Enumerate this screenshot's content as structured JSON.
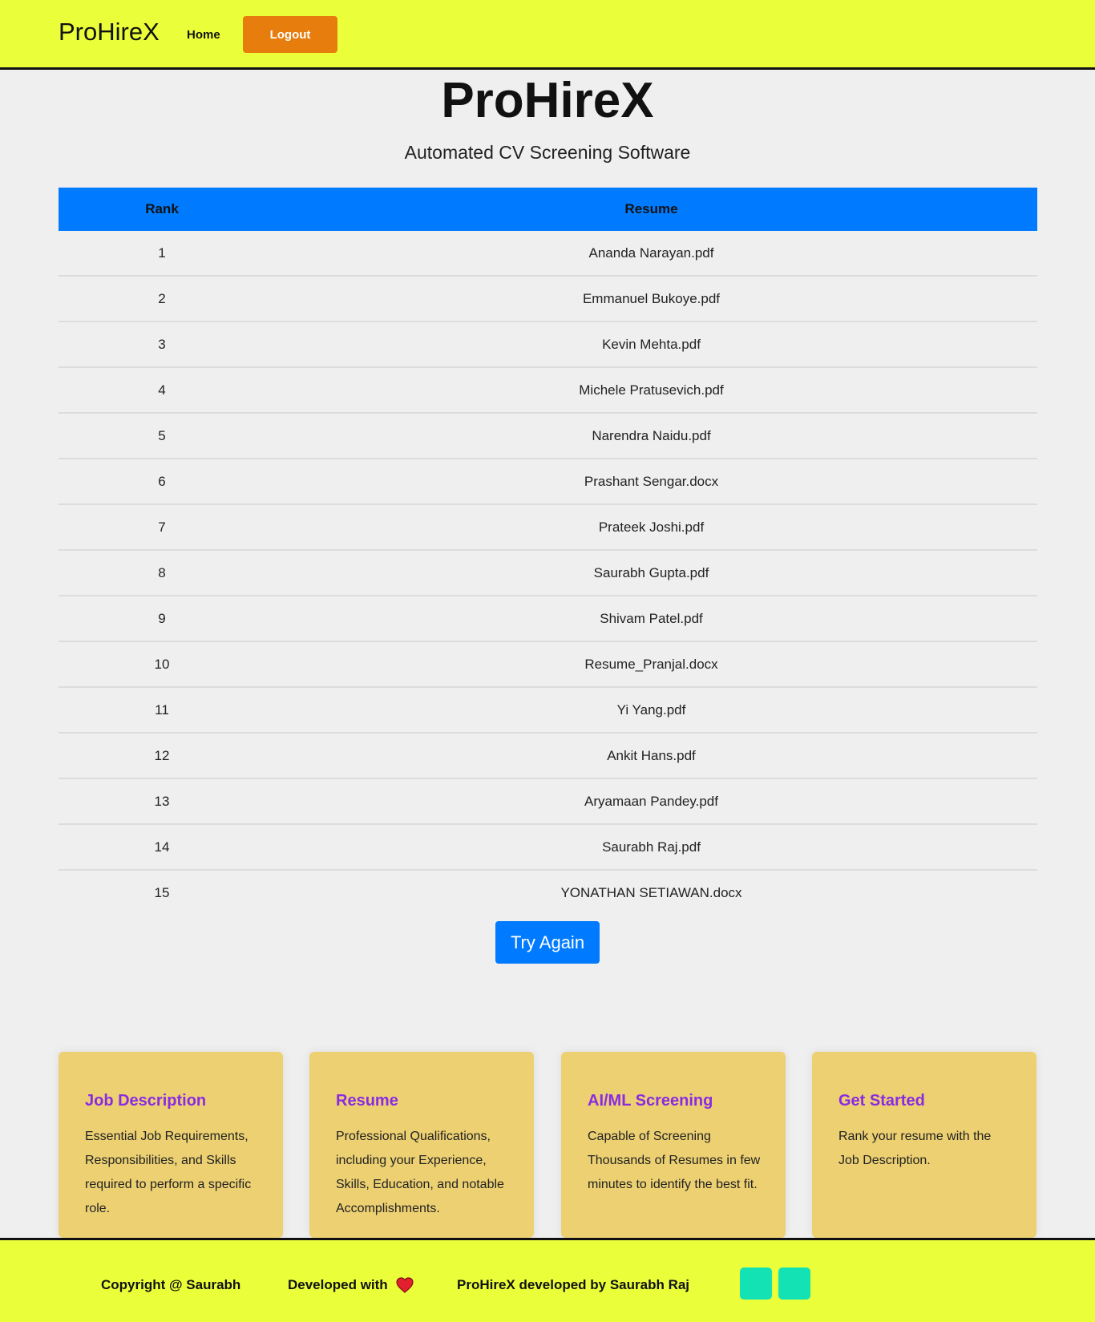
{
  "header": {
    "brand": "ProHireX",
    "nav_home": "Home",
    "logout_label": "Logout"
  },
  "hero": {
    "title": "ProHireX",
    "subtitle": "Automated CV Screening Software"
  },
  "table": {
    "columns": [
      "Rank",
      "Resume"
    ],
    "rows": [
      {
        "rank": "1",
        "resume": "Ananda Narayan.pdf"
      },
      {
        "rank": "2",
        "resume": "Emmanuel Bukoye.pdf"
      },
      {
        "rank": "3",
        "resume": "Kevin Mehta.pdf"
      },
      {
        "rank": "4",
        "resume": "Michele Pratusevich.pdf"
      },
      {
        "rank": "5",
        "resume": "Narendra Naidu.pdf"
      },
      {
        "rank": "6",
        "resume": "Prashant Sengar.docx"
      },
      {
        "rank": "7",
        "resume": "Prateek Joshi.pdf"
      },
      {
        "rank": "8",
        "resume": "Saurabh Gupta.pdf"
      },
      {
        "rank": "9",
        "resume": "Shivam Patel.pdf"
      },
      {
        "rank": "10",
        "resume": "Resume_Pranjal.docx"
      },
      {
        "rank": "11",
        "resume": "Yi Yang.pdf"
      },
      {
        "rank": "12",
        "resume": "Ankit Hans.pdf"
      },
      {
        "rank": "13",
        "resume": "Aryamaan Pandey.pdf"
      },
      {
        "rank": "14",
        "resume": "Saurabh Raj.pdf"
      },
      {
        "rank": "15",
        "resume": "YONATHAN SETIAWAN.docx"
      }
    ]
  },
  "try_again_label": "Try Again",
  "cards": [
    {
      "title": "Job Description",
      "text": "Essential Job Requirements, Responsibilities, and Skills required to perform a specific role."
    },
    {
      "title": "Resume",
      "text": "Professional Qualifications, including your Experience, Skills, Education, and notable Accomplishments."
    },
    {
      "title": "AI/ML Screening",
      "text": "Capable of Screening Thousands of Resumes in few minutes to identify the best fit."
    },
    {
      "title": "Get Started",
      "text": "Rank your resume with the Job Description."
    }
  ],
  "footer": {
    "copyright": "Copyright @ Saurabh",
    "developed_with": "Developed with",
    "heart_icon": "heart-icon",
    "credit": "ProHireX developed by Saurabh Raj",
    "social_icons": [
      "social-link-1",
      "social-link-2"
    ],
    "colors": {
      "bar": "#eaff39",
      "social": "#13e2b5",
      "heart": "#e3202d"
    }
  }
}
